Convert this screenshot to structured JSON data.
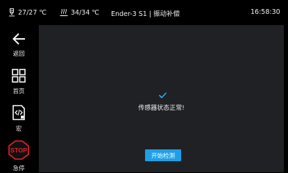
{
  "status_bar": {
    "nozzle_temp": "27/27 ℃",
    "bed_temp": "34/34 ℃",
    "title": "Ender-3 S1 | 振动补偿",
    "time": "16:58:30"
  },
  "sidebar": {
    "items": [
      {
        "label": "返回",
        "icon": "back-arrow-icon"
      },
      {
        "label": "首页",
        "icon": "home-grid-icon"
      },
      {
        "label": "宏",
        "icon": "macro-code-icon"
      },
      {
        "label": "急停",
        "icon": "stop-icon",
        "icon_text": "STOP"
      }
    ]
  },
  "main": {
    "message": "传感器状态正常!",
    "start_button": "开始检测"
  },
  "colors": {
    "accent": "#1e9fe8",
    "check": "#29b3ec",
    "stop": "#d8202a",
    "panel": "#202124"
  }
}
